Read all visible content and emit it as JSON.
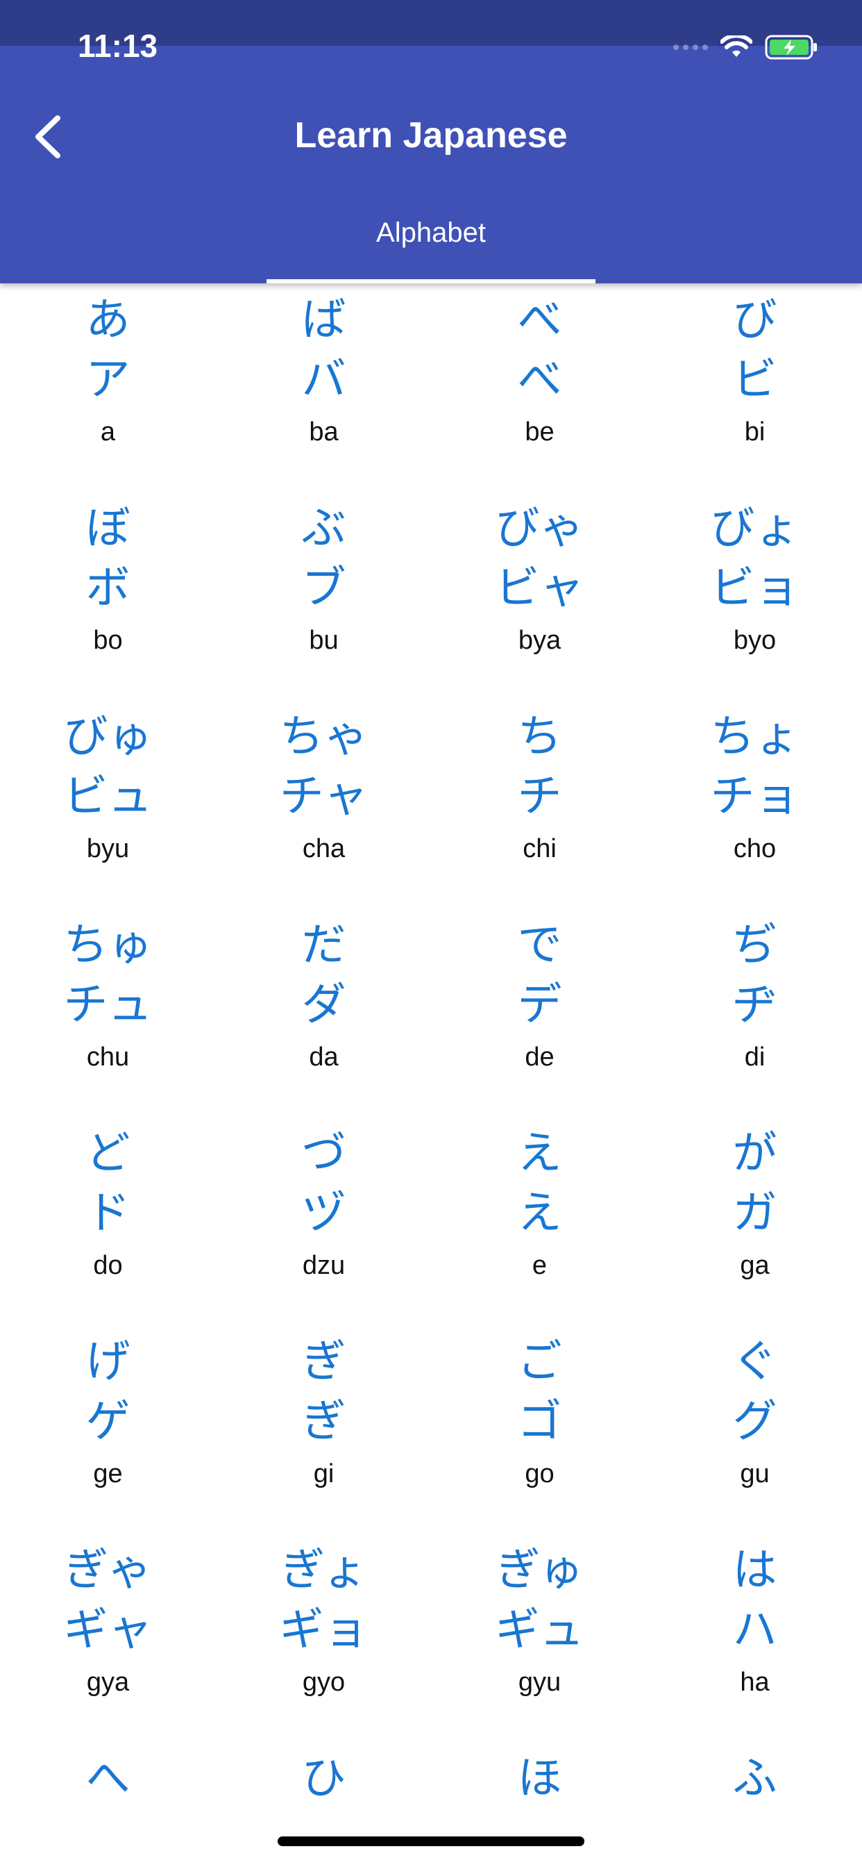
{
  "status_bar": {
    "time": "11:13"
  },
  "header": {
    "title": "Learn Japanese",
    "back_icon": "chevron-left-icon",
    "tab_label": "Alphabet",
    "color": "#3f51b5"
  },
  "colors": {
    "kana": "#1976d2",
    "romaji": "#111111"
  },
  "alphabet": [
    {
      "hiragana": "あ",
      "katakana": "ア",
      "romaji": "a"
    },
    {
      "hiragana": "ば",
      "katakana": "バ",
      "romaji": "ba"
    },
    {
      "hiragana": "べ",
      "katakana": "べ",
      "romaji": "be"
    },
    {
      "hiragana": "び",
      "katakana": "ビ",
      "romaji": "bi"
    },
    {
      "hiragana": "ぼ",
      "katakana": "ボ",
      "romaji": "bo"
    },
    {
      "hiragana": "ぶ",
      "katakana": "ブ",
      "romaji": "bu"
    },
    {
      "hiragana": "びゃ",
      "katakana": "ビャ",
      "romaji": "bya"
    },
    {
      "hiragana": "びょ",
      "katakana": "ビョ",
      "romaji": "byo"
    },
    {
      "hiragana": "びゅ",
      "katakana": "ビュ",
      "romaji": "byu"
    },
    {
      "hiragana": "ちゃ",
      "katakana": "チャ",
      "romaji": "cha"
    },
    {
      "hiragana": "ち",
      "katakana": "チ",
      "romaji": "chi"
    },
    {
      "hiragana": "ちょ",
      "katakana": "チョ",
      "romaji": "cho"
    },
    {
      "hiragana": "ちゅ",
      "katakana": "チュ",
      "romaji": "chu"
    },
    {
      "hiragana": "だ",
      "katakana": "ダ",
      "romaji": "da"
    },
    {
      "hiragana": "で",
      "katakana": "デ",
      "romaji": "de"
    },
    {
      "hiragana": "ぢ",
      "katakana": "ヂ",
      "romaji": "di"
    },
    {
      "hiragana": "ど",
      "katakana": "ド",
      "romaji": "do"
    },
    {
      "hiragana": "づ",
      "katakana": "ヅ",
      "romaji": "dzu"
    },
    {
      "hiragana": "え",
      "katakana": "え",
      "romaji": "e"
    },
    {
      "hiragana": "が",
      "katakana": "ガ",
      "romaji": "ga"
    },
    {
      "hiragana": "げ",
      "katakana": "ゲ",
      "romaji": "ge"
    },
    {
      "hiragana": "ぎ",
      "katakana": "ぎ",
      "romaji": "gi"
    },
    {
      "hiragana": "ご",
      "katakana": "ゴ",
      "romaji": "go"
    },
    {
      "hiragana": "ぐ",
      "katakana": "グ",
      "romaji": "gu"
    },
    {
      "hiragana": "ぎゃ",
      "katakana": "ギャ",
      "romaji": "gya"
    },
    {
      "hiragana": "ぎょ",
      "katakana": "ギョ",
      "romaji": "gyo"
    },
    {
      "hiragana": "ぎゅ",
      "katakana": "ギュ",
      "romaji": "gyu"
    },
    {
      "hiragana": "は",
      "katakana": "ハ",
      "romaji": "ha"
    },
    {
      "hiragana": "へ",
      "katakana": "",
      "romaji": ""
    },
    {
      "hiragana": "ひ",
      "katakana": "",
      "romaji": ""
    },
    {
      "hiragana": "ほ",
      "katakana": "",
      "romaji": ""
    },
    {
      "hiragana": "ふ",
      "katakana": "",
      "romaji": ""
    }
  ]
}
